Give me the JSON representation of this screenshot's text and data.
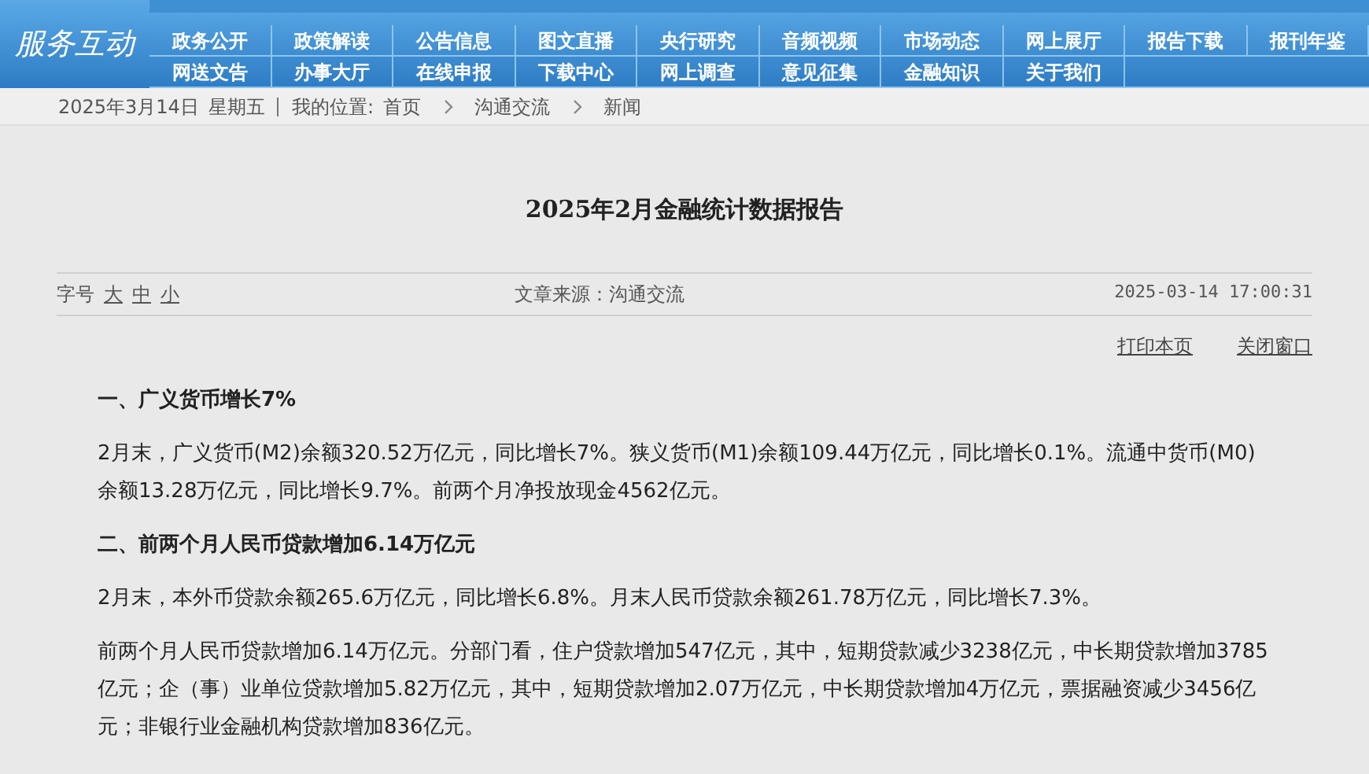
{
  "header": {
    "logo": "服务互动",
    "nav_rows": [
      [
        "政务公开",
        "政策解读",
        "公告信息",
        "图文直播",
        "央行研究",
        "音频视频",
        "市场动态",
        "网上展厅",
        "报告下载",
        "报刊年鉴"
      ],
      [
        "网送文告",
        "办事大厅",
        "在线申报",
        "下载中心",
        "网上调查",
        "意见征集",
        "金融知识",
        "关于我们"
      ]
    ]
  },
  "breadcrumb": {
    "date": "2025年3月14日",
    "weekday": "星期五",
    "location_label": "我的位置:",
    "items": [
      "首页",
      "沟通交流",
      "新闻"
    ]
  },
  "article": {
    "title": "2025年2月金融统计数据报告",
    "font_size_label": "字号",
    "font_sizes": [
      "大",
      "中",
      "小"
    ],
    "source": "文章来源：沟通交流",
    "datetime": "2025-03-14 17:00:31",
    "actions": [
      "打印本页",
      "关闭窗口"
    ],
    "blocks": [
      {
        "kind": "heading",
        "text": "一、广义货币增长7%"
      },
      {
        "kind": "paragraph",
        "text": "2月末，广义货币(M2)余额320.52万亿元，同比增长7%。狭义货币(M1)余额109.44万亿元，同比增长0.1%。流通中货币(M0)余额13.28万亿元，同比增长9.7%。前两个月净投放现金4562亿元。"
      },
      {
        "kind": "heading",
        "text": "二、前两个月人民币贷款增加6.14万亿元"
      },
      {
        "kind": "paragraph",
        "text": "2月末，本外币贷款余额265.6万亿元，同比增长6.8%。月末人民币贷款余额261.78万亿元，同比增长7.3%。"
      },
      {
        "kind": "paragraph",
        "text": "前两个月人民币贷款增加6.14万亿元。分部门看，住户贷款增加547亿元，其中，短期贷款减少3238亿元，中长期贷款增加3785亿元；企（事）业单位贷款增加5.82万亿元，其中，短期贷款增加2.07万亿元，中长期贷款增加4万亿元，票据融资减少3456亿元；非银行业金融机构贷款增加836亿元。"
      }
    ]
  }
}
